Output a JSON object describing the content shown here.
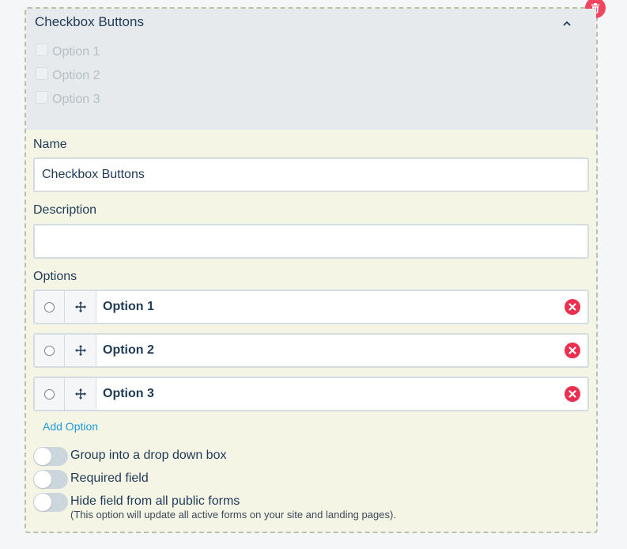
{
  "preview": {
    "title": "Checkbox Buttons",
    "options": [
      "Option 1",
      "Option 2",
      "Option 3"
    ]
  },
  "form": {
    "name_label": "Name",
    "name_value": "Checkbox Buttons",
    "description_label": "Description",
    "description_value": "",
    "options_label": "Options",
    "options": [
      {
        "value": "Option 1"
      },
      {
        "value": "Option 2"
      },
      {
        "value": "Option 3"
      }
    ],
    "add_option_label": "Add Option"
  },
  "toggles": {
    "group": {
      "label": "Group into a drop down box",
      "on": false
    },
    "required": {
      "label": "Required field",
      "on": false
    },
    "hide": {
      "label": "Hide field from all public forms",
      "note": "(This option will update all active forms on your site and landing pages).",
      "on": false
    }
  },
  "icons": {
    "delete": "trash-icon",
    "collapse": "chevron-up-icon",
    "drag": "move-icon",
    "remove": "remove-circle-icon"
  },
  "colors": {
    "accent_link": "#1e9ad6",
    "danger": "#f0455f",
    "text": "#1f3a56"
  }
}
